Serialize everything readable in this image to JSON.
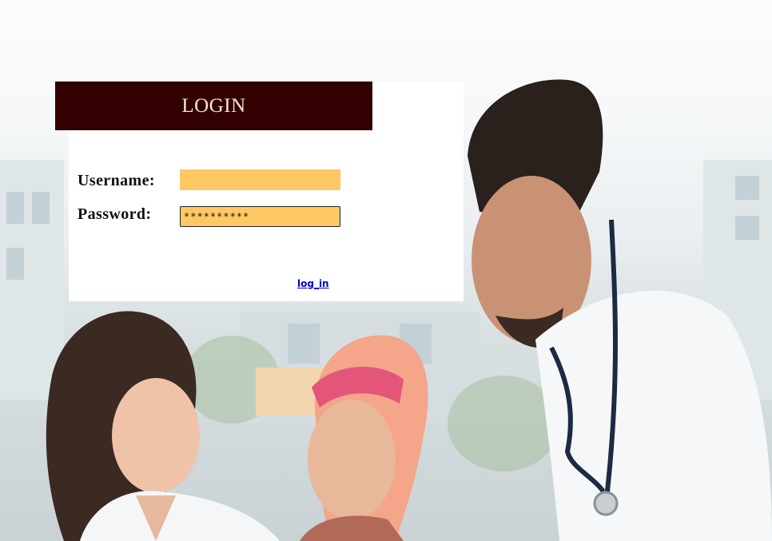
{
  "login": {
    "title": "LOGIN",
    "username_label": "Username:",
    "password_label": "Password:",
    "username_value": "",
    "password_value": "**********",
    "submit_link": "log_in"
  },
  "colors": {
    "header_bg": "#330000",
    "header_text": "#f3ead4",
    "input_bg": "#ffc864",
    "link": "#0000cc"
  },
  "background": {
    "image_subject": "two-doctors-with-patient-photo"
  }
}
